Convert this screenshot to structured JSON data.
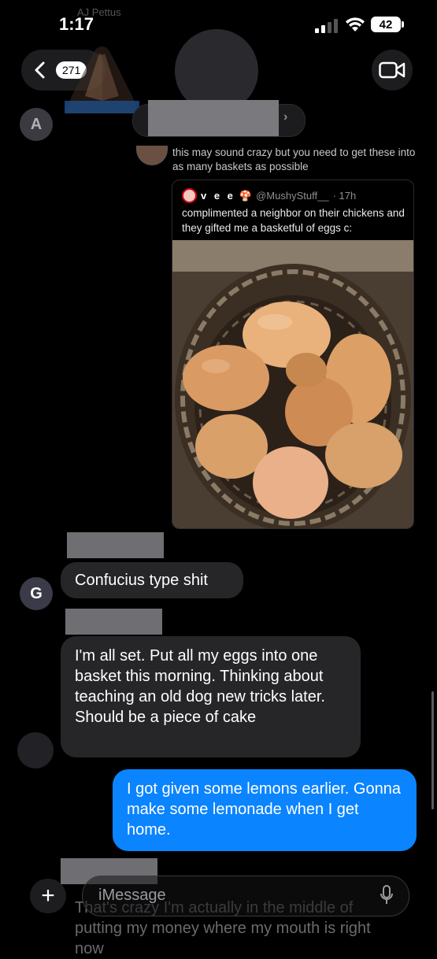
{
  "status_bar": {
    "time": "1:17",
    "battery": "42",
    "background_name": "AJ Pettus"
  },
  "header": {
    "back_count": "271"
  },
  "contacts": {
    "a_initial": "A",
    "g_initial": "G"
  },
  "shared_tweet": {
    "caption": "this may sound crazy but you need to get these into as many baskets as possible",
    "display_name": "v e e",
    "handle": "@MushyStuff__",
    "time": "· 17h",
    "text": "complimented a neighbor on their chickens and they gifted me a basketful of eggs c:"
  },
  "messages": [
    {
      "text": "Confucius type shit"
    },
    {
      "text": "I'm all set. Put all my eggs into one basket this morning. Thinking about teaching an old dog new tricks later. Should be a piece of cake"
    },
    {
      "text": "I got given some lemons earlier. Gonna make some lemonade when I get home."
    }
  ],
  "composer": {
    "placeholder": "iMessage",
    "partial_text": "That's crazy I'm actually in the middle of putting my money where my mouth is right now"
  }
}
